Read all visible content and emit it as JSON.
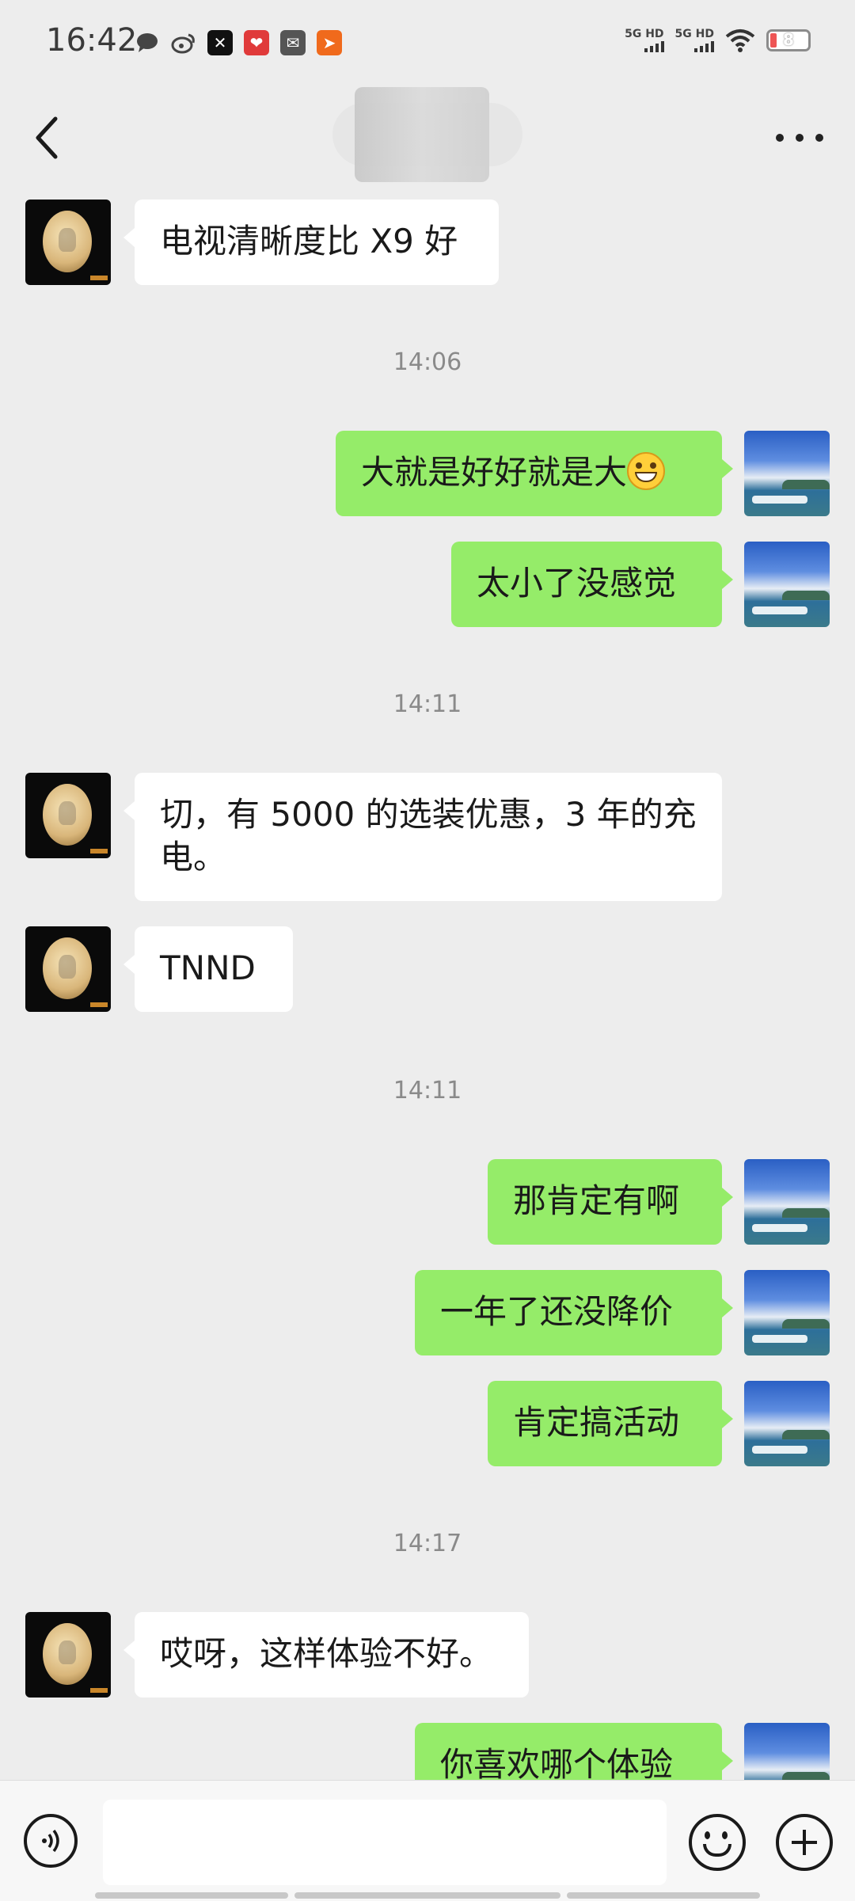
{
  "status_bar": {
    "time": "16:42",
    "network_1": "5G HD",
    "network_2": "5G HD",
    "battery": "8",
    "notification_icons": [
      "message-bubble-icon",
      "weibo-icon",
      "x-app-icon",
      "red-app-icon",
      "mail-icon",
      "send-app-icon"
    ]
  },
  "nav_bar": {
    "back_icon": "chevron-left-icon",
    "more_icon": "more-dots-icon"
  },
  "messages": [
    {
      "side": "in",
      "text": "电视清晰度比 X9 好"
    },
    {
      "type": "time",
      "text": "14:06"
    },
    {
      "side": "out",
      "text": "大就是好好就是大",
      "emoji": "grinning-face-emoji"
    },
    {
      "side": "out",
      "text": "太小了没感觉"
    },
    {
      "type": "time",
      "text": "14:11"
    },
    {
      "side": "in",
      "text": "切，有 5000 的选装优惠，3 年的充电。"
    },
    {
      "side": "in",
      "text": "TNND"
    },
    {
      "type": "time",
      "text": "14:11"
    },
    {
      "side": "out",
      "text": "那肯定有啊"
    },
    {
      "side": "out",
      "text": "一年了还没降价"
    },
    {
      "side": "out",
      "text": "肯定搞活动"
    },
    {
      "type": "time",
      "text": "14:17"
    },
    {
      "side": "in",
      "text": "哎呀，这样体验不好。"
    },
    {
      "side": "out",
      "text": "你喜欢哪个体验"
    }
  ],
  "input_bar": {
    "voice_icon": "voice-icon",
    "emoji_icon": "emoji-icon",
    "plus_icon": "plus-icon",
    "value": ""
  },
  "colors": {
    "background": "#ededed",
    "incoming_bubble": "#ffffff",
    "outgoing_bubble": "#95ec69"
  }
}
